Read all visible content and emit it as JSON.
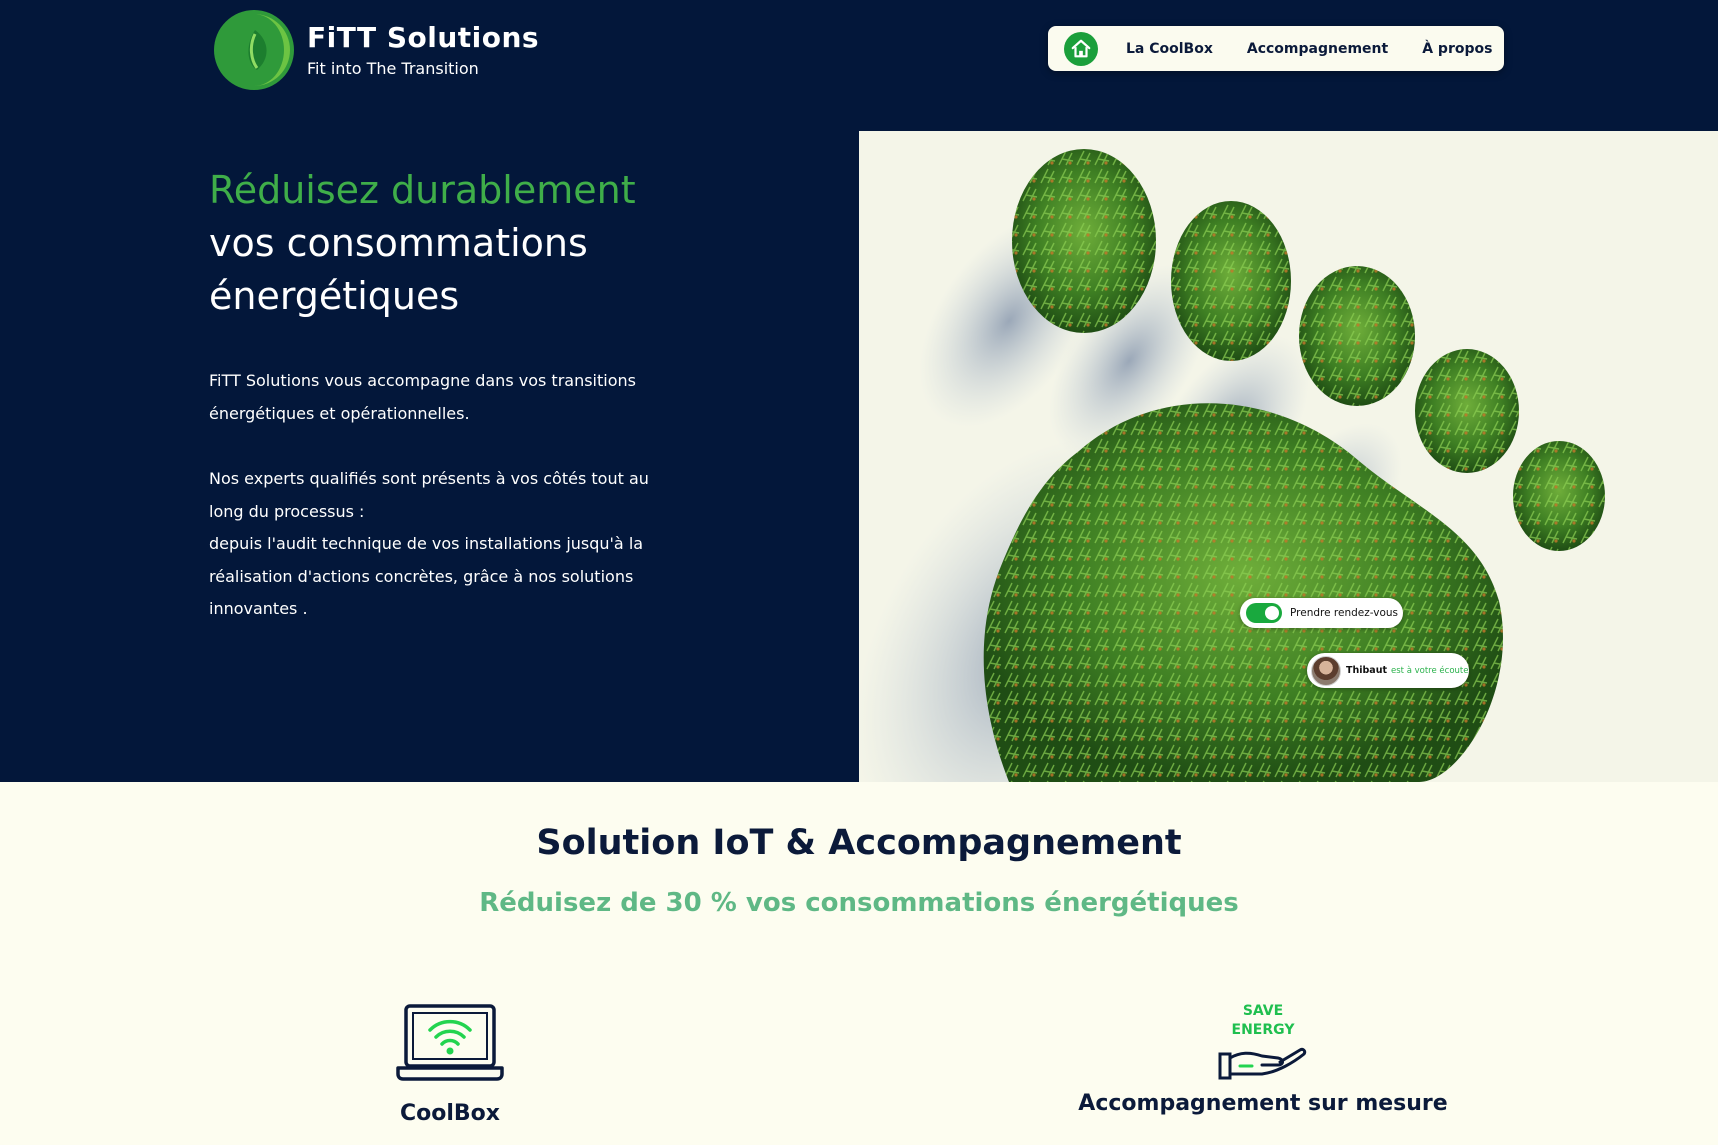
{
  "brand": {
    "name": "FiTT Solutions",
    "tagline": "Fit into The Transition"
  },
  "nav": {
    "home_icon": "home-icon",
    "items": [
      {
        "label": "La CoolBox"
      },
      {
        "label": "Accompagnement"
      },
      {
        "label": "À propos"
      }
    ]
  },
  "hero": {
    "headline_green": "Réduisez durablement",
    "headline_line2": "vos consommations",
    "headline_line3": "énergétiques",
    "intro_p1": "FiTT Solutions vous accompagne dans vos transitions énergétiques et opérationnelles.",
    "intro_p2_line1": "Nos experts qualifiés sont présents à vos côtés tout au long du processus :",
    "intro_p2_line2": "depuis l'audit technique de vos installations jusqu'à la réalisation d'actions concrètes, grâce à nos solutions innovantes ."
  },
  "chips": {
    "appointment_label": "Prendre rendez-vous",
    "contact_name": "Thibaut",
    "contact_status": "est à votre écoute"
  },
  "section": {
    "title": "Solution IoT & Accompagnement",
    "subtitle": "Réduisez de 30 % vos consommations énergétiques"
  },
  "features": [
    {
      "title": "CoolBox",
      "icon": "laptop-wifi-icon"
    },
    {
      "title": "Accompagnement sur mesure",
      "icon": "save-energy-hand-icon",
      "badge_line1": "SAVE",
      "badge_line2": "ENERGY"
    }
  ],
  "colors": {
    "navy": "#03173a",
    "accent_green": "#3fae49",
    "subtitle_green": "#5fb885",
    "cream": "#fdfdf0"
  }
}
